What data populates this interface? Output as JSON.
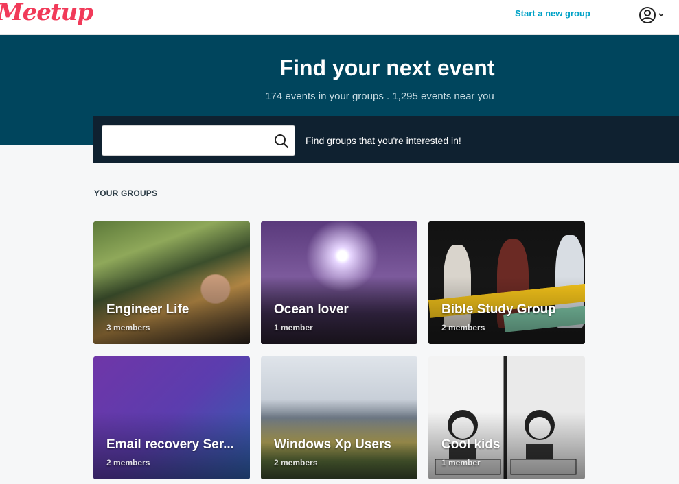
{
  "header": {
    "logo_text": "Meetup",
    "start_group_label": "Start a new group"
  },
  "hero": {
    "title": "Find your next event",
    "subtitle": "174 events in your groups . 1,295 events near you"
  },
  "search": {
    "value": "",
    "hint": "Find groups that you're interested in!"
  },
  "groups": {
    "section_title": "YOUR GROUPS",
    "items": [
      {
        "name": "Engineer Life",
        "members": "3 members"
      },
      {
        "name": "Ocean lover",
        "members": "1 member"
      },
      {
        "name": "Bible Study Group",
        "members": "2 members"
      },
      {
        "name": "Email recovery Ser...",
        "members": "2 members"
      },
      {
        "name": "Windows Xp Users",
        "members": "2 members"
      },
      {
        "name": "Cool kids",
        "members": "1 member"
      }
    ]
  },
  "colors": {
    "brand": "#f13a59",
    "accent_link": "#00a2c7",
    "hero_bg": "#00455d",
    "search_band_bg": "#0f2130"
  }
}
